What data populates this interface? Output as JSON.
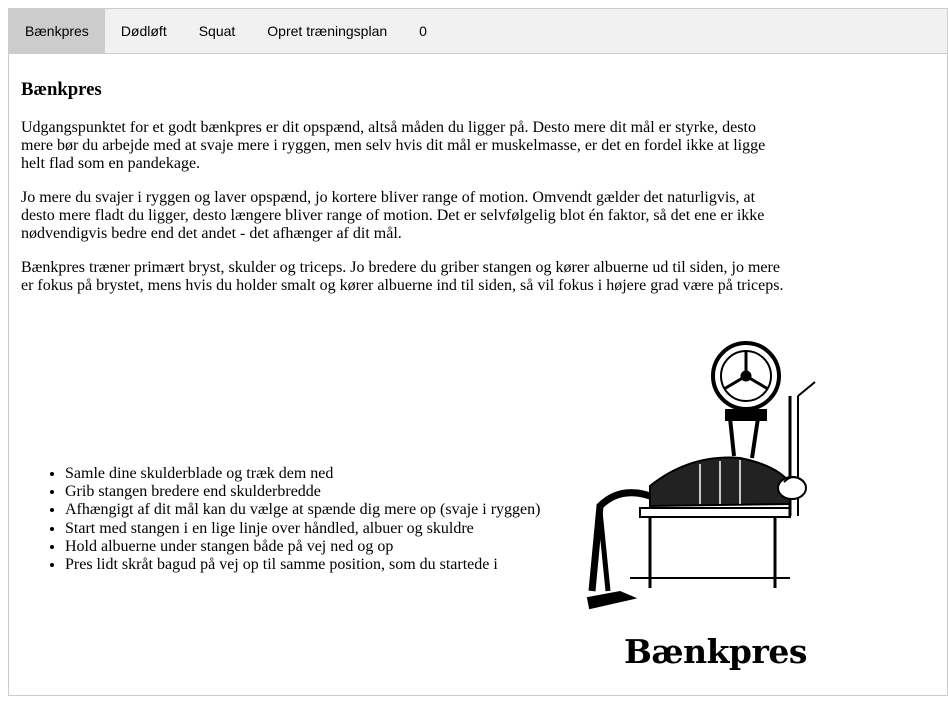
{
  "tabs": [
    {
      "label": "Bænkpres",
      "active": true
    },
    {
      "label": "Dødløft",
      "active": false
    },
    {
      "label": "Squat",
      "active": false
    },
    {
      "label": "Opret træningsplan",
      "active": false
    },
    {
      "label": "0",
      "active": false
    }
  ],
  "article": {
    "title": "Bænkpres",
    "paragraphs": [
      "Udgangspunktet for et godt bænkpres er dit opspænd, altså måden du ligger på. Desto mere dit mål er styrke, desto mere bør du arbejde med at svaje mere i ryggen, men selv hvis dit mål er muskelmasse, er det en fordel ikke at ligge helt flad som en pandekage.",
      "Jo mere du svajer i ryggen og laver opspænd, jo kortere bliver range of motion. Omvendt gælder det naturligvis, at desto mere fladt du ligger, desto længere bliver range of motion. Det er selvfølgelig blot én faktor, så det ene er ikke nødvendigvis bedre end det andet - det afhænger af dit mål.",
      "Bænkpres træner primært bryst, skulder og triceps. Jo bredere du griber stangen og kører albuerne ud til siden, jo mere er fokus på brystet, mens hvis du holder smalt og kører albuerne ind til siden, så vil fokus i højere grad være på triceps."
    ],
    "tips": [
      "Samle dine skulderblade og træk dem ned",
      "Grib stangen bredere end skulderbredde",
      "Afhængigt af dit mål kan du vælge at spænde dig mere op (svaje i ryggen)",
      "Start med stangen i en lige linje over håndled, albuer og skuldre",
      "Hold albuerne under stangen både på vej ned og op",
      "Pres lidt skråt bagud på vej op til samme position, som du startede i"
    ],
    "figure_caption": "Bænkpres"
  },
  "colors": {
    "tabbar_bg": "#f1f1f1",
    "tab_active_bg": "#cccccc",
    "border": "#cccccc"
  }
}
